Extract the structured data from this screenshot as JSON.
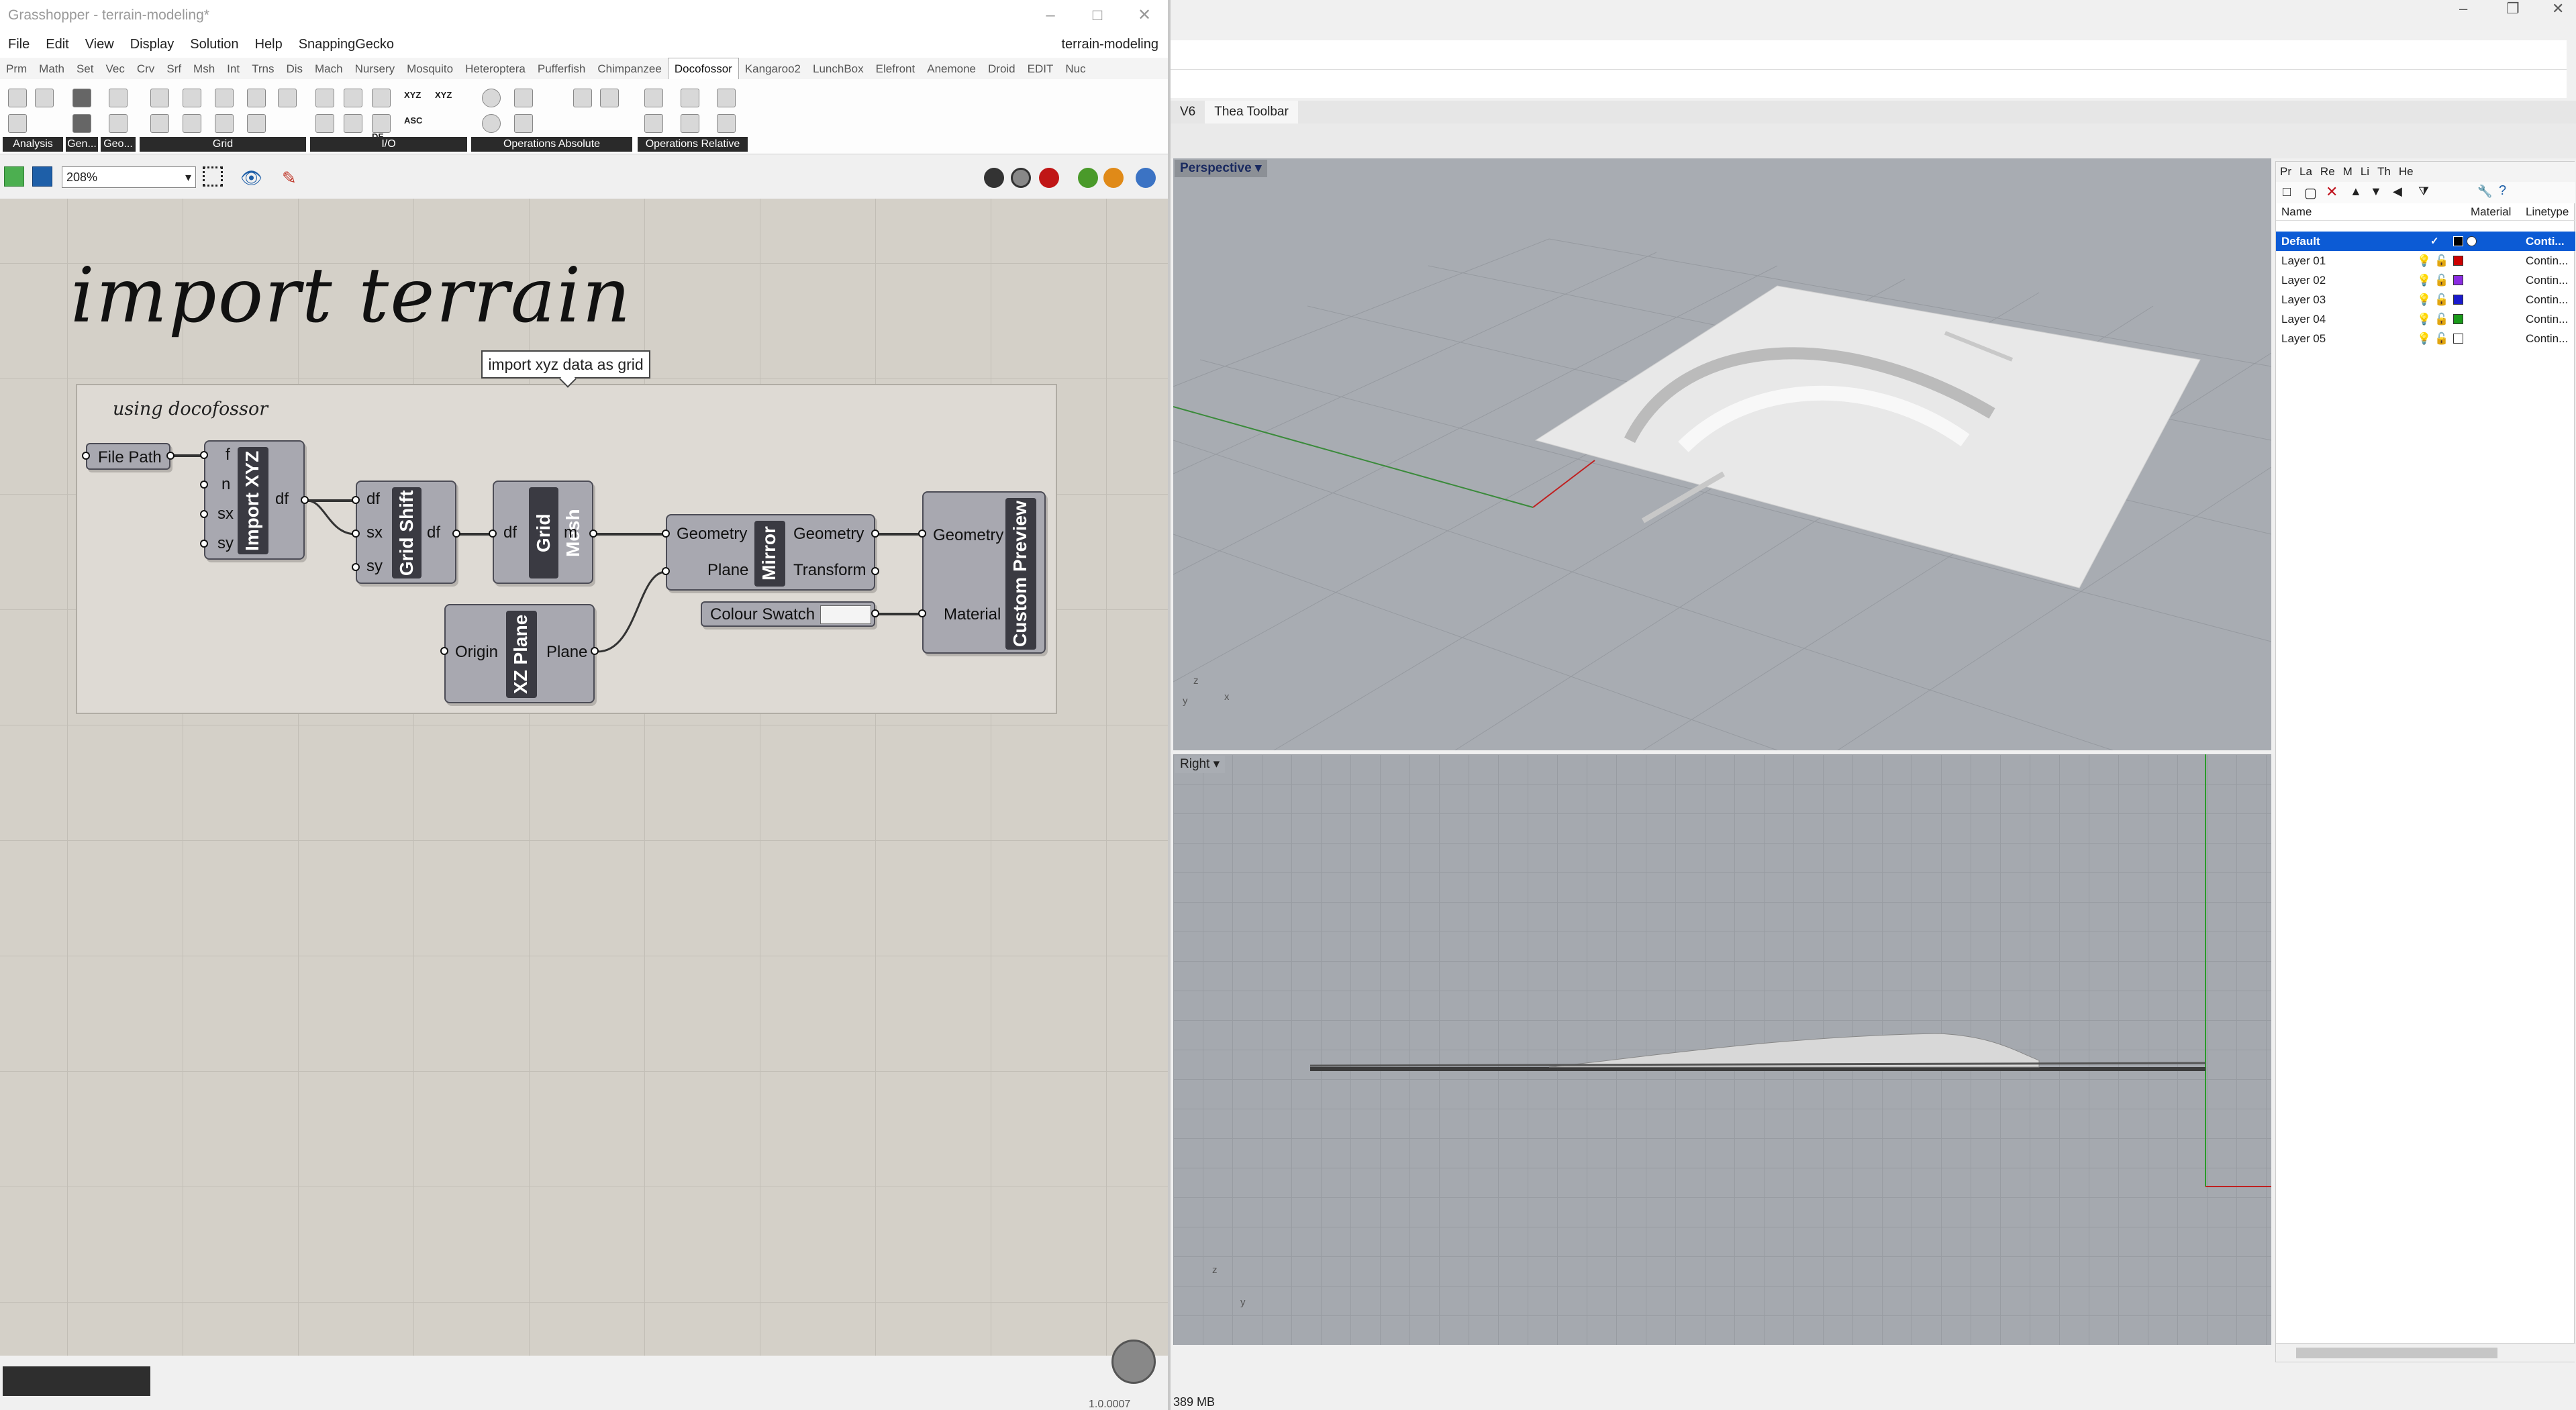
{
  "grasshopper": {
    "window_title": "Grasshopper - terrain-modeling*",
    "document_name": "terrain-modeling",
    "menu": [
      "File",
      "Edit",
      "View",
      "Display",
      "Solution",
      "Help",
      "SnappingGecko"
    ],
    "tabs": [
      "Prm",
      "Math",
      "Set",
      "Vec",
      "Crv",
      "Srf",
      "Msh",
      "Int",
      "Trns",
      "Dis",
      "Mach",
      "Nursery",
      "Mosquito",
      "Heteroptera",
      "Pufferfish",
      "Chimpanzee",
      "Docofossor",
      "Kangaroo2",
      "LunchBox",
      "Elefront",
      "Anemone",
      "Droid",
      "EDIT",
      "Nuc"
    ],
    "active_tab": "Docofossor",
    "ribbon_groups": [
      "Analysis",
      "Gen...",
      "Geo...",
      "Grid",
      "I/O",
      "Operations Absolute",
      "Operations Relative"
    ],
    "ribbon_icon_text": [
      "XYZ",
      "ASC",
      "XYZ",
      "ASC",
      "DF"
    ],
    "zoom": "208%",
    "version": "1.0.0007",
    "canvas": {
      "title": "import terrain",
      "group_label": "using docofossor",
      "callout": "import xyz data as grid",
      "components": {
        "file_path": "File Path",
        "import_xyz": {
          "name": "Import XYZ",
          "inputs": [
            "f",
            "n",
            "sx",
            "sy"
          ],
          "outputs": [
            "df"
          ]
        },
        "grid_shift": {
          "name": "Grid Shift",
          "inputs": [
            "df",
            "sx",
            "sy"
          ],
          "outputs": [
            "df"
          ]
        },
        "grid_mesh": {
          "name": "Grid Mesh",
          "inputs": [
            "df"
          ],
          "outputs": [
            "m"
          ]
        },
        "mirror": {
          "name": "Mirror",
          "inputs": [
            "Geometry",
            "Plane"
          ],
          "outputs": [
            "Geometry",
            "Transform"
          ]
        },
        "xz_plane": {
          "name": "XZ Plane",
          "inputs": [
            "Origin"
          ],
          "outputs": [
            "Plane"
          ]
        },
        "colour_swatch": "Colour Swatch",
        "custom_preview": {
          "name": "Custom Preview",
          "inputs": [
            "Geometry",
            "Material"
          ]
        }
      }
    }
  },
  "rhino": {
    "tabs": [
      "V6",
      "Thea Toolbar"
    ],
    "viewports": {
      "top_label": "Perspective",
      "bottom_label": "Right"
    },
    "axis_labels": {
      "z": "z",
      "y": "y",
      "x": "x"
    },
    "layer_panel": {
      "tabs": [
        "Pr",
        "La",
        "Re",
        "M",
        "Li",
        "Th",
        "He"
      ],
      "columns": {
        "name": "Name",
        "material": "Material",
        "linetype": "Linetype"
      },
      "layers": [
        {
          "name": "Default",
          "linetype": "Conti...",
          "color": "#000000",
          "selected": true
        },
        {
          "name": "Layer 01",
          "linetype": "Contin...",
          "color": "#cc0000"
        },
        {
          "name": "Layer 02",
          "linetype": "Contin...",
          "color": "#8a2be2"
        },
        {
          "name": "Layer 03",
          "linetype": "Contin...",
          "color": "#1a1acc"
        },
        {
          "name": "Layer 04",
          "linetype": "Contin...",
          "color": "#1a9a1a"
        },
        {
          "name": "Layer 05",
          "linetype": "Contin...",
          "color": "#ffffff"
        }
      ]
    },
    "memory": "389 MB"
  }
}
